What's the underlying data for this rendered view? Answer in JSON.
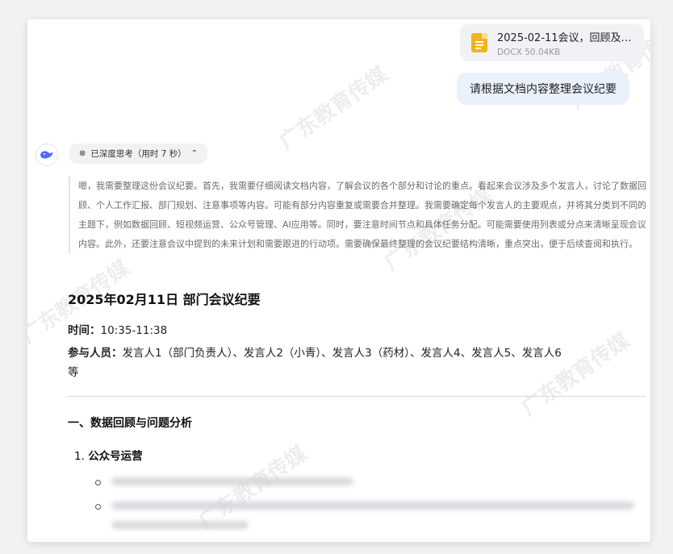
{
  "file": {
    "name": "2025-02-11会议，回顾及…",
    "size": "DOCX 50.04KB",
    "icon": "document-icon"
  },
  "user_message": "请根据文档内容整理会议纪要",
  "assistant": {
    "avatar_icon": "whale-logo-icon",
    "think_toggle": "已深度思考（用时 7 秒）",
    "think_text": "嗯，我需要整理这份会议纪要。首先，我需要仔细阅读文档内容，了解会议的各个部分和讨论的重点。看起来会议涉及多个发言人，讨论了数据回顾、个人工作汇报、部门规划、注意事项等内容。可能有部分内容重复或需要合并整理。我需要确定每个发言人的主要观点，并将其分类到不同的主题下，例如数据回顾、短视频运营、公众号管理、AI应用等。同时，要注意时间节点和具体任务分配。可能需要使用列表或分点来清晰呈现会议内容。此外，还要注意会议中提到的未来计划和需要跟进的行动项。需要确保最终整理的会议纪要结构清晰，重点突出，便于后续查阅和执行。",
    "doc_title": "2025年02月11日 部门会议纪要",
    "time_label": "时间",
    "time_value": "10:35-11:38",
    "attendees_label": "参与人员",
    "attendees_line1": "发言人1（部门负责人）、发言人2（小青）、发言人3（药材）、发言人4、发言人5、发言人6",
    "attendees_line2": "等",
    "section1": "一、数据回顾与问题分析",
    "sub1_number": "1.",
    "sub1_title": "公众号运营"
  },
  "watermark": "广东教育传媒",
  "colors": {
    "user_bubble": "#eaf1fd",
    "file_card": "#f1f2f6",
    "file_icon": "#f3b31b",
    "accent": "#4d6bfe"
  }
}
